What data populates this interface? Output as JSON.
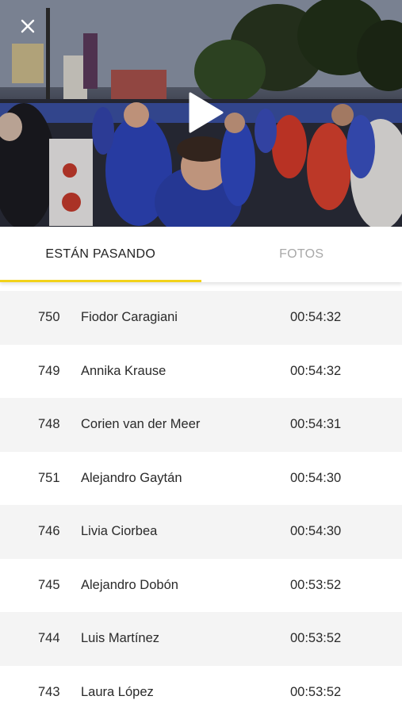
{
  "video": {
    "close_icon": "close-icon",
    "play_icon": "play-icon"
  },
  "tabs": [
    {
      "label": "ESTÁN PASANDO",
      "active": true
    },
    {
      "label": "FOTOS",
      "active": false
    }
  ],
  "colors": {
    "accent": "#f2d21a",
    "row_alt": "#f4f4f4"
  },
  "runners": [
    {
      "bib": "750",
      "name": "Fiodor Caragiani",
      "time": "00:54:32"
    },
    {
      "bib": "749",
      "name": "Annika Krause",
      "time": "00:54:32"
    },
    {
      "bib": "748",
      "name": "Corien van der Meer",
      "time": "00:54:31"
    },
    {
      "bib": "751",
      "name": "Alejandro Gaytán",
      "time": "00:54:30"
    },
    {
      "bib": "746",
      "name": "Livia Ciorbea",
      "time": "00:54:30"
    },
    {
      "bib": "745",
      "name": "Alejandro Dobón",
      "time": "00:53:52"
    },
    {
      "bib": "744",
      "name": "Luis Martínez",
      "time": "00:53:52"
    },
    {
      "bib": "743",
      "name": "Laura López",
      "time": "00:53:52"
    }
  ]
}
